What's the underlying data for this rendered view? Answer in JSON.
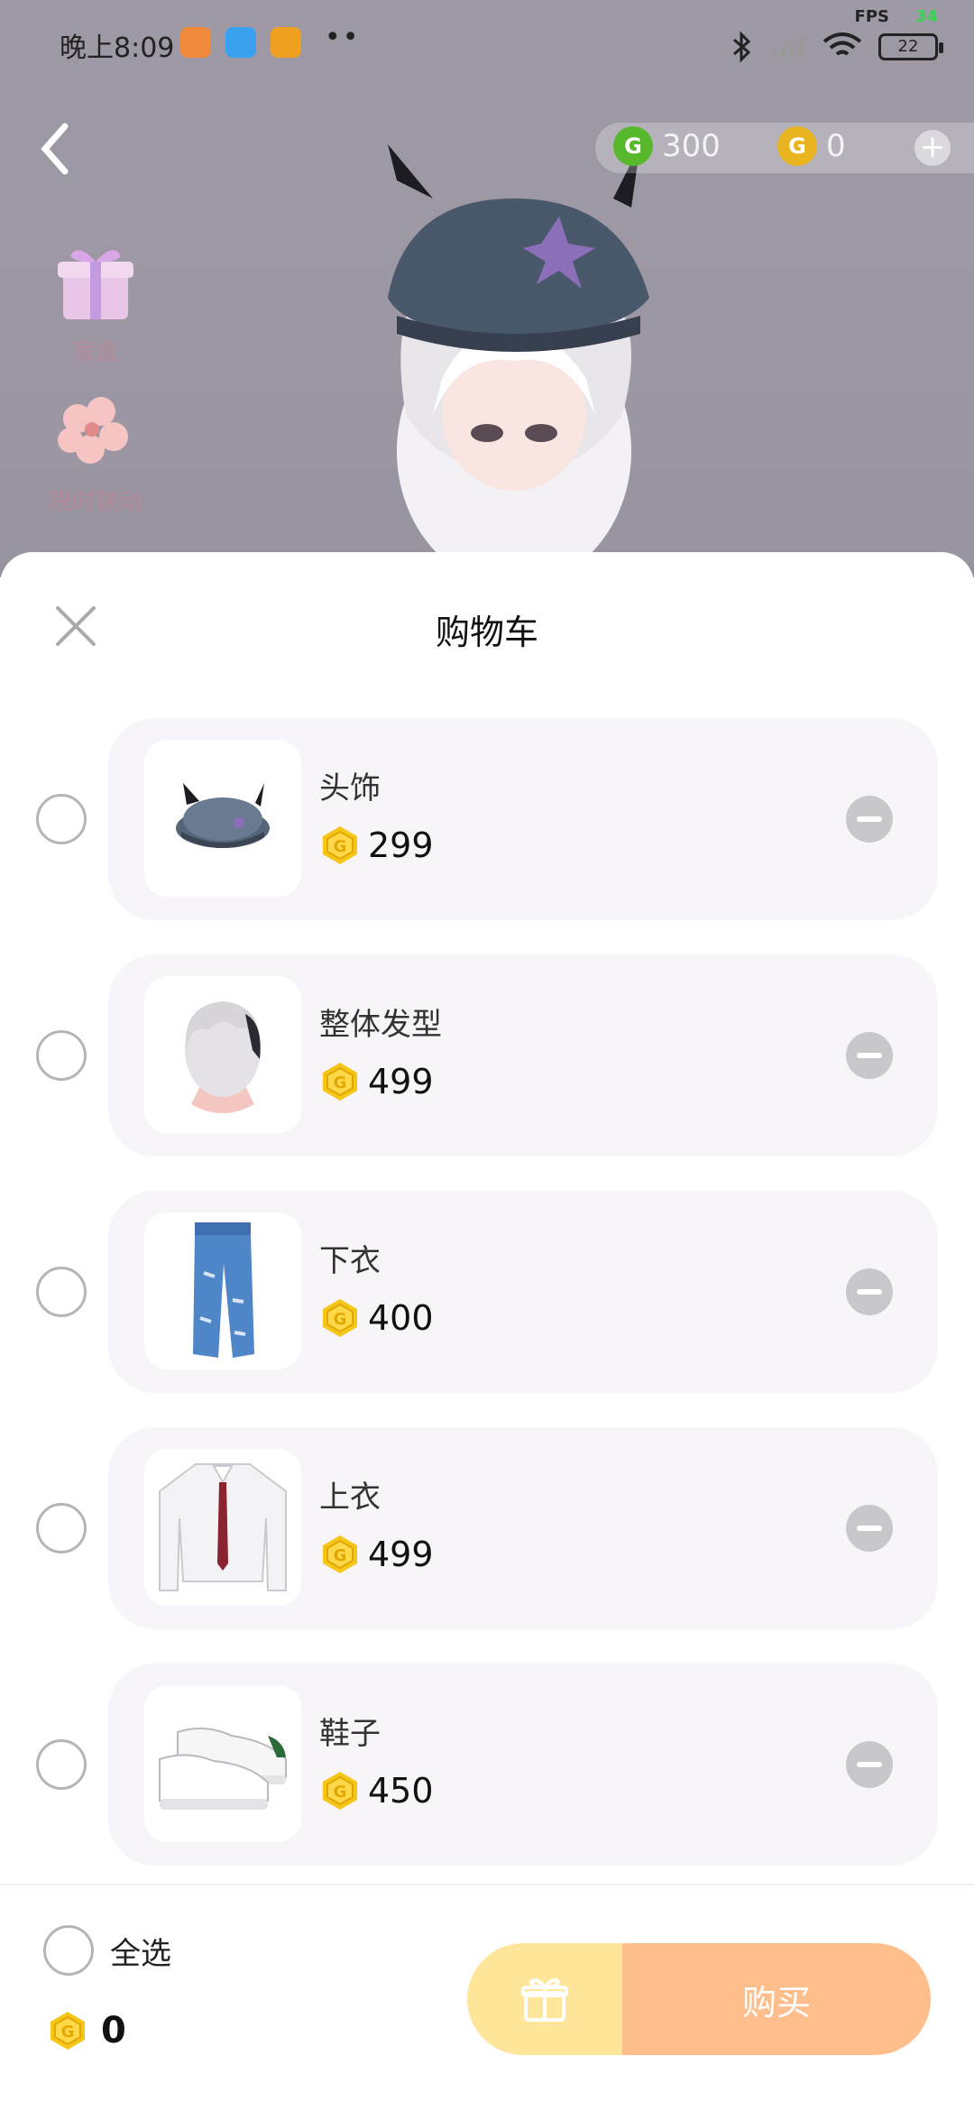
{
  "status_bar": {
    "time": "晚上8:09",
    "dots": "••",
    "fps_label": "FPS",
    "fps_value": "34",
    "battery": "22"
  },
  "background": {
    "currency": [
      {
        "icon": "green-g-coin-icon",
        "value": "300",
        "color": "#58b82c"
      },
      {
        "icon": "gold-g-coin-icon",
        "value": "0",
        "color": "#e8b520"
      }
    ],
    "side_menu": [
      {
        "icon": "gift-box-icon",
        "label": "盲盒"
      },
      {
        "icon": "flower-icon",
        "label": "限时联动"
      }
    ]
  },
  "cart": {
    "title": "购物车",
    "items": [
      {
        "name": "头饰",
        "price": "299",
        "thumb": "hat-icon"
      },
      {
        "name": "整体发型",
        "price": "499",
        "thumb": "hair-icon"
      },
      {
        "name": "下衣",
        "price": "400",
        "thumb": "jeans-icon"
      },
      {
        "name": "上衣",
        "price": "499",
        "thumb": "shirt-icon"
      },
      {
        "name": "鞋子",
        "price": "450",
        "thumb": "sneakers-icon"
      }
    ],
    "footer": {
      "select_all_label": "全选",
      "total": "0",
      "buy_label": "购买"
    }
  },
  "colors": {
    "coin_gold": "#f5c518",
    "gift_button": "#ffe69a",
    "buy_button": "#ffbe8c",
    "card_bg": "#f7f5f9"
  }
}
